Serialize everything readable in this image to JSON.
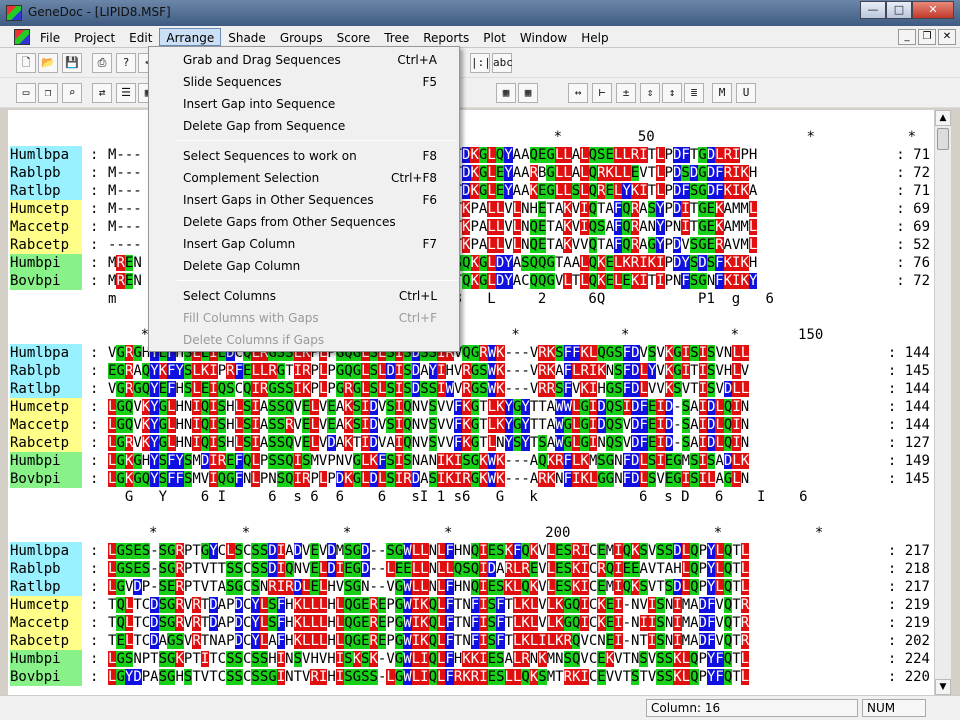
{
  "window": {
    "title": "GeneDoc - [LIPID8.MSF]"
  },
  "menus": [
    "File",
    "Project",
    "Edit",
    "Arrange",
    "Shade",
    "Groups",
    "Score",
    "Tree",
    "Reports",
    "Plot",
    "Window",
    "Help"
  ],
  "arrange_menu": [
    {
      "label": "Grab and Drag Sequences",
      "shortcut": "Ctrl+A",
      "enabled": true
    },
    {
      "label": "Slide Sequences",
      "shortcut": "F5",
      "enabled": true
    },
    {
      "label": "Insert Gap into Sequence",
      "shortcut": "",
      "enabled": true
    },
    {
      "label": "Delete Gap from Sequence",
      "shortcut": "",
      "enabled": true
    },
    {
      "label": "Select Sequences to work on",
      "shortcut": "F8",
      "enabled": true
    },
    {
      "label": "Complement Selection",
      "shortcut": "Ctrl+F8",
      "enabled": true
    },
    {
      "label": "Insert Gaps in Other Sequences",
      "shortcut": "F6",
      "enabled": true
    },
    {
      "label": "Delete Gaps from Other Sequences",
      "shortcut": "",
      "enabled": true
    },
    {
      "label": "Insert Gap Column",
      "shortcut": "F7",
      "enabled": true
    },
    {
      "label": "Delete Gap Column",
      "shortcut": "",
      "enabled": true
    },
    {
      "label": "Select Columns",
      "shortcut": "Ctrl+L",
      "enabled": true
    },
    {
      "label": "Fill Columns with Gaps",
      "shortcut": "Ctrl+F",
      "enabled": false
    },
    {
      "label": "Delete Columns if Gaps",
      "shortcut": "",
      "enabled": false
    }
  ],
  "toolbar1": [
    "new-doc-icon",
    "open-folder-icon",
    "save-icon",
    "print-icon",
    "help-icon",
    "pointer-icon",
    "column-marker-icon",
    "abc-icon"
  ],
  "toolbar2": [
    "copy-icon",
    "copy-seq-icon",
    "find-icon",
    "arrange-icon",
    "report-icon",
    "grid-icon",
    "grid2-icon",
    "grid3-icon",
    "arrow-lr-icon",
    "bracket-icon",
    "plus-minus-icon",
    "spacer-icon",
    "dot-icon",
    "list-icon",
    "m-icon",
    "u-icon"
  ],
  "blocks": [
    {
      "ruler_top": "                                                       *         50                  *           *",
      "rows": [
        {
          "name": "Humlbpa",
          "color": "cyan",
          "seq": "M---                                LVARITDKGLQYAAQEGLLALQSELLRITLPDFTGDLRIPH",
          "num": "71"
        },
        {
          "name": "Rablpb",
          "color": "cyan",
          "seq": "M---                                LITRITDKGLEYAARBGLLALQRKLLEVTLPDSDGDFRIKH",
          "num": "72"
        },
        {
          "name": "Ratlbp",
          "color": "cyan",
          "seq": "M---                                MVVRITDKGLEYAAKEGLLSLQRELYKITLPDFSGDFKIKA",
          "num": "71"
        },
        {
          "name": "Humcetp",
          "color": "yellow",
          "seq": "M---                                IVCRITKPALLVLNHETAKVIQTAFQRASYPDITGEKAMML",
          "num": "69"
        },
        {
          "name": "Maccetp",
          "color": "yellow",
          "seq": "M---                                IVCRITKPALLVLNQETAKVIQSAFQRANYPNITGEKAMML",
          "num": "69"
        },
        {
          "name": "Rabcetp",
          "color": "yellow",
          "seq": "----                                IVCRITKPALLVLNQETAKVVQTAFQRAGYPDVSGERAVML",
          "num": "52"
        },
        {
          "name": "Humbpi",
          "color": "green",
          "seq": "MREN                                VVVRISQKGLDYASQQGTAALQKELKRIKIPDYSDSFKIKH",
          "num": "76"
        },
        {
          "name": "Bovbpi",
          "color": "green",
          "seq": "MREN                                IVARITQKGLDYACQQGVLTLQKELEKITIPNFSGNFKIKY",
          "num": "72"
        }
      ],
      "ruler_bottom": "m                                   66 RI3   L     2     6Q           P1  g   6"
    },
    {
      "ruler_top": "      *                                           *            *            *       150",
      "rows": [
        {
          "name": "Humlbpa",
          "color": "cyan",
          "seq": "VGRGHYEFHSLEIEDCQLRGSSLKPLPGQGLSLSISDSSIRVQGRWK---VRKSFFKLQGSFDVSVKGISISVNLL",
          "num": "144"
        },
        {
          "name": "Rablpb",
          "color": "cyan",
          "seq": "EGRAQYKFYSLKIPRFELLRGTIRPLPGQGLSLDISDAYIHVRGSWK---VRKAFLRIKNSFDLYVKGITISVHLV",
          "num": "145"
        },
        {
          "name": "Ratlbp",
          "color": "cyan",
          "seq": "VGRGQYEFHSLEIQSCQIRGSSIKPLPGRGLSLSISDSSIWVRGSWK---VRRSFVKIHGSFDLVVKSVTISVDLL",
          "num": "144"
        },
        {
          "name": "Humcetp",
          "color": "yellow",
          "seq": "LGQVKYGLHNIQISHLSIASSQVELVEAKSIDVSIQNVSVVFKGTLKYGYTTAWWLGIDQSIDFEID-SAIDLQIN",
          "num": "144"
        },
        {
          "name": "Maccetp",
          "color": "yellow",
          "seq": "LGQVKYGLHNIQISHLSIASSRVELVEAKSIDVSIQNVSVVFKGTLKYGYTTAWGLGIDQSVDFEID-SAIDLQIN",
          "num": "144"
        },
        {
          "name": "Rabcetp",
          "color": "yellow",
          "seq": "LGRVKYGLHNIQISHLSIASSQVELVDAKTIDVAIQNVSVVFKGTLNYSYTSAWGLGINQSVDFEID-SAIDLQIN",
          "num": "127"
        },
        {
          "name": "Humbpi",
          "color": "green",
          "seq": "LGKGHYSFYSMDIREFQLPSSQISMVPNVGLKFSISNANIKISGKWK---AQKRFLKMSGNFDLSIEGMSISADLK",
          "num": "149"
        },
        {
          "name": "Bovbpi",
          "color": "green",
          "seq": "LGKGQYSFFSMVIQGFNLPNSQIRPLPDKGLDLSIRDASIKIRGKWK---ARKNFIKLGGNFDLSVEGISILAGLN",
          "num": "145"
        }
      ],
      "ruler_bottom": "  G   Y    6 I     6  s 6  6    6   sI 1 s6   G   k            6  s D   6    I    6"
    },
    {
      "ruler_top": "       *          *           *           *           200                 *           *",
      "rows": [
        {
          "name": "Humlbpa",
          "color": "cyan",
          "seq": "LGSES-SGRPTGYCLSCSSDIADVEVDMSGD--SGWLLNLFHNQIESKFQKVLESRICEMIQKSVSSDLQPYLQTL",
          "num": "217"
        },
        {
          "name": "Rablpb",
          "color": "cyan",
          "seq": "LGSES-SGRPTVTTSSCSSDIQNVELDIEGD--LEELLNLLQSQIDARLREVLESKICRQIEEAVTAHLQPYLQTL",
          "num": "218"
        },
        {
          "name": "Ratlbp",
          "color": "cyan",
          "seq": "LGVDP-SERPTVTASGCSNRIRDLELHVSGN--VGWLLNLFHNQIESKLQKVLESKICEMIQKSVTSDLQPYLQTL",
          "num": "217"
        },
        {
          "name": "Humcetp",
          "color": "yellow",
          "seq": "TQLTCDSGRVRTDAPDCYLSFHKLLLHLQGEREPGWIKQLFTNFISFTLKLVLKGQICKEI-NVISNIMADFVQTR",
          "num": "219"
        },
        {
          "name": "Maccetp",
          "color": "yellow",
          "seq": "TQLTCDSGRVRTDAPDCYLSFHKLLLHLQGEREPGWIKQLFTNFISFTLKLVLKGQICKEI-NIISNIMADFVQTR",
          "num": "219"
        },
        {
          "name": "Rabcetp",
          "color": "yellow",
          "seq": "TELTCDAGSVRTNAPDCYLAFHKLLLHLQGEREPGWIKQLFTNFISFTLKLILKRQVCNEI-NTISNIMADFVQTR",
          "num": "202"
        },
        {
          "name": "Humbpi",
          "color": "green",
          "seq": "LGSNPTSGKPTITCSSCSSHINSVHVHISKSK-VGWLIQLFHKKIESALRNKMNSQVCEKVTNSVSSKLQPYFQTL",
          "num": "224"
        },
        {
          "name": "Bovbpi",
          "color": "green",
          "seq": "LGYDPASGHSTVTCSSCSSGINTVRIHISGSS-LGWLIQLFRKRIESLLQKSMTRKICEVVTSTVSSKLQPYFQTL",
          "num": "220"
        }
      ],
      "ruler_bottom": ""
    }
  ],
  "status": {
    "column": "Column: 16",
    "num": "NUM"
  }
}
